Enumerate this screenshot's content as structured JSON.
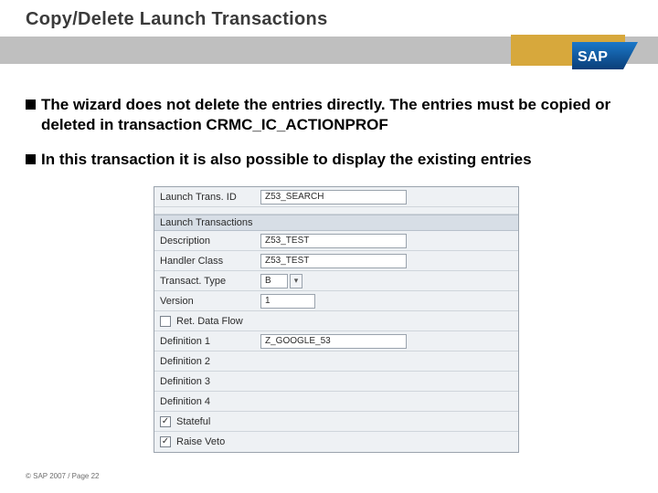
{
  "title": "Copy/Delete Launch Transactions",
  "logo_text": "SAP",
  "bullets": [
    "The wizard does not delete the entries directly. The entries must be copied or deleted in transaction CRMC_IC_ACTIONPROF",
    "In this transaction it is also possible to display the existing entries"
  ],
  "panel": {
    "launch_trans_id_label": "Launch Trans. ID",
    "launch_trans_id_value": "Z53_SEARCH",
    "section_header": "Launch Transactions",
    "description_label": "Description",
    "description_value": "Z53_TEST",
    "handler_class_label": "Handler Class",
    "handler_class_value": "Z53_TEST",
    "transact_type_label": "Transact. Type",
    "transact_type_value": "B",
    "version_label": "Version",
    "version_value": "1",
    "ret_dataflow_label": "Ret. Data Flow",
    "definition1_label": "Definition 1",
    "definition1_value": "Z_GOOGLE_53",
    "definition2_label": "Definition 2",
    "definition3_label": "Definition 3",
    "definition4_label": "Definition 4",
    "stateful_label": "Stateful",
    "raise_veto_label": "Raise Veto"
  },
  "footer": "© SAP 2007 / Page 22"
}
